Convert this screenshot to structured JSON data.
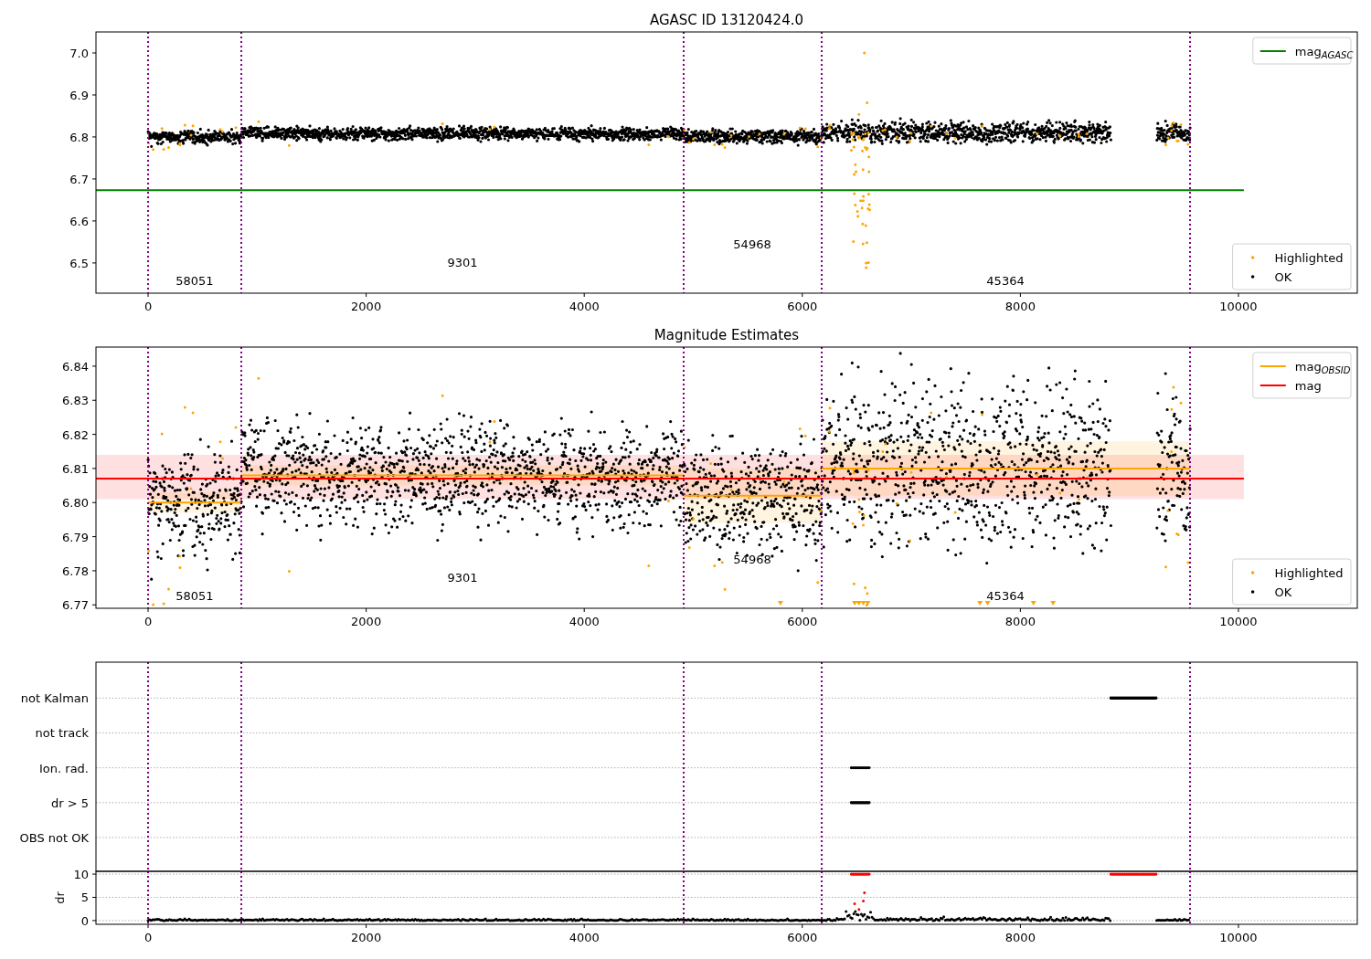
{
  "panels": [
    {
      "kind": "magnitude",
      "chart_data": {
        "type": "line",
        "title": "AGASC ID 13120424.0",
        "x": [
          -478,
          10050
        ],
        "series": [
          {
            "name": "mag$_{AGASC}$",
            "color": "#008000",
            "values": [
              6.673,
              6.673
            ]
          }
        ],
        "xlim": [
          -478,
          11090
        ],
        "ylim": [
          6.428,
          7.05
        ],
        "xticks": [
          0,
          2000,
          4000,
          6000,
          8000,
          10000
        ],
        "yticks": [
          6.5,
          6.6,
          6.7,
          6.8,
          6.9,
          {
            "value": 7.0,
            "label": "7.0"
          }
        ],
        "ref_lines": [
          {
            "axis": "x",
            "value": 0
          },
          {
            "axis": "x",
            "value": 855
          },
          {
            "axis": "x",
            "value": 4912
          },
          {
            "axis": "x",
            "value": 6178
          },
          {
            "axis": "x",
            "value": 9556
          }
        ],
        "legend": true,
        "annotations": [
          "58051",
          "9301",
          "54968",
          "45364"
        ]
      },
      "point_legend": [
        {
          "label": "Highlighted",
          "color": "#ffa500"
        },
        {
          "label": "OK",
          "color": "#000000"
        }
      ]
    },
    {
      "kind": "magnitude",
      "chart_data": {
        "type": "line",
        "title": "Magnitude Estimates",
        "x": [
          -478,
          0,
          855,
          855,
          4912,
          4912,
          6178,
          6178,
          9556,
          10050
        ],
        "series": [
          {
            "name": "mag$_{OBSID}$",
            "color": "#ffa500",
            "values": [
              null,
              6.8,
              6.8,
              6.808,
              6.808,
              6.802,
              6.802,
              6.81,
              6.81,
              null
            ]
          },
          {
            "name": "mag",
            "color": "#ff0000",
            "values": [
              6.807,
              6.807,
              6.807,
              6.807,
              6.807,
              6.807,
              6.807,
              6.807,
              6.807,
              6.807
            ]
          }
        ],
        "bands": [
          {
            "axis": "y",
            "from": 6.801,
            "to": 6.814,
            "color": "#ff0000"
          }
        ],
        "xlim": [
          -478,
          11090
        ],
        "ylim": [
          6.769,
          6.8456
        ],
        "xticks": [
          0,
          2000,
          4000,
          6000,
          8000,
          10000
        ],
        "yticks": [
          6.77,
          6.78,
          6.79,
          {
            "value": 6.8,
            "label": "6.80"
          },
          6.81,
          6.82,
          6.83,
          6.84
        ],
        "ref_lines": [
          {
            "axis": "x",
            "value": 0
          },
          {
            "axis": "x",
            "value": 855
          },
          {
            "axis": "x",
            "value": 4912
          },
          {
            "axis": "x",
            "value": 6178
          },
          {
            "axis": "x",
            "value": 9556
          }
        ],
        "legend": true,
        "annotations": [
          "58051",
          "9301",
          "54968",
          "45364"
        ]
      },
      "point_legend": [
        {
          "label": "Highlighted",
          "color": "#ffa500"
        },
        {
          "label": "OK",
          "color": "#000000"
        }
      ]
    },
    {
      "kind": "flags",
      "chart_data": {
        "type": "scatter",
        "orientation": "horizontal",
        "xlim": [
          -478,
          11090
        ],
        "categories": [
          "not Kalman",
          "not track",
          "Ion. rad.",
          "dr > 5",
          "OBS not OK"
        ],
        "grid": true,
        "ref_lines": [
          {
            "axis": "x",
            "value": 0
          },
          {
            "axis": "x",
            "value": 855
          },
          {
            "axis": "x",
            "value": 4912
          },
          {
            "axis": "x",
            "value": 6178
          },
          {
            "axis": "x",
            "value": 9556
          }
        ]
      }
    },
    {
      "kind": "dr",
      "chart_data": {
        "type": "scatter",
        "ylabel": "dr",
        "xlim": [
          -478,
          11090
        ],
        "ylim": [
          -0.8,
          10.6
        ],
        "xticks": [
          0,
          2000,
          4000,
          6000,
          8000,
          10000
        ],
        "yticks": [
          0,
          5,
          10
        ],
        "grid": true,
        "ref_lines": [
          {
            "axis": "x",
            "value": 0
          },
          {
            "axis": "x",
            "value": 855
          },
          {
            "axis": "x",
            "value": 4912
          },
          {
            "axis": "x",
            "value": 6178
          },
          {
            "axis": "x",
            "value": 9556
          }
        ]
      }
    }
  ]
}
